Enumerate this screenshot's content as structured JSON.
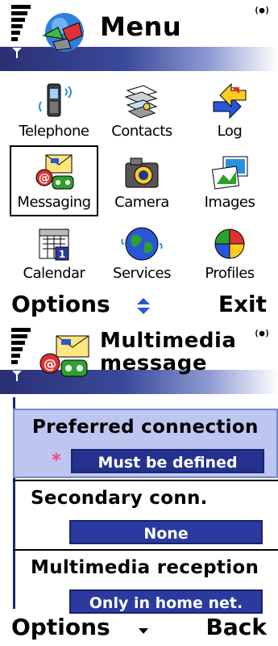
{
  "status": {
    "battery": "(●)"
  },
  "menu": {
    "title": "Menu",
    "items": [
      {
        "label": "Telephone",
        "icon": "telephone-icon"
      },
      {
        "label": "Contacts",
        "icon": "contacts-icon"
      },
      {
        "label": "Log",
        "icon": "log-icon"
      },
      {
        "label": "Messaging",
        "icon": "messaging-icon",
        "selected": true
      },
      {
        "label": "Camera",
        "icon": "camera-icon"
      },
      {
        "label": "Images",
        "icon": "images-icon"
      },
      {
        "label": "Calendar",
        "icon": "calendar-icon"
      },
      {
        "label": "Services",
        "icon": "globe-icon"
      },
      {
        "label": "Profiles",
        "icon": "profiles-icon"
      }
    ],
    "softkeys": {
      "left": "Options",
      "right": "Exit"
    }
  },
  "mms": {
    "title_line1": "Multimedia",
    "title_line2": "message",
    "settings": [
      {
        "label": "Preferred connection",
        "value": "Must be defined",
        "focused": true,
        "required_mark": "*"
      },
      {
        "label": "Secondary conn.",
        "value": "None"
      },
      {
        "label": "Multimedia reception",
        "value": "Only in home net."
      }
    ],
    "softkeys": {
      "left": "Options",
      "right": "Back"
    }
  },
  "colors": {
    "band_dark": "#2a2f74",
    "value_fill": "#2a3a9e",
    "focus_fill": "#bcc6ee",
    "required": "#ff3b7a"
  }
}
